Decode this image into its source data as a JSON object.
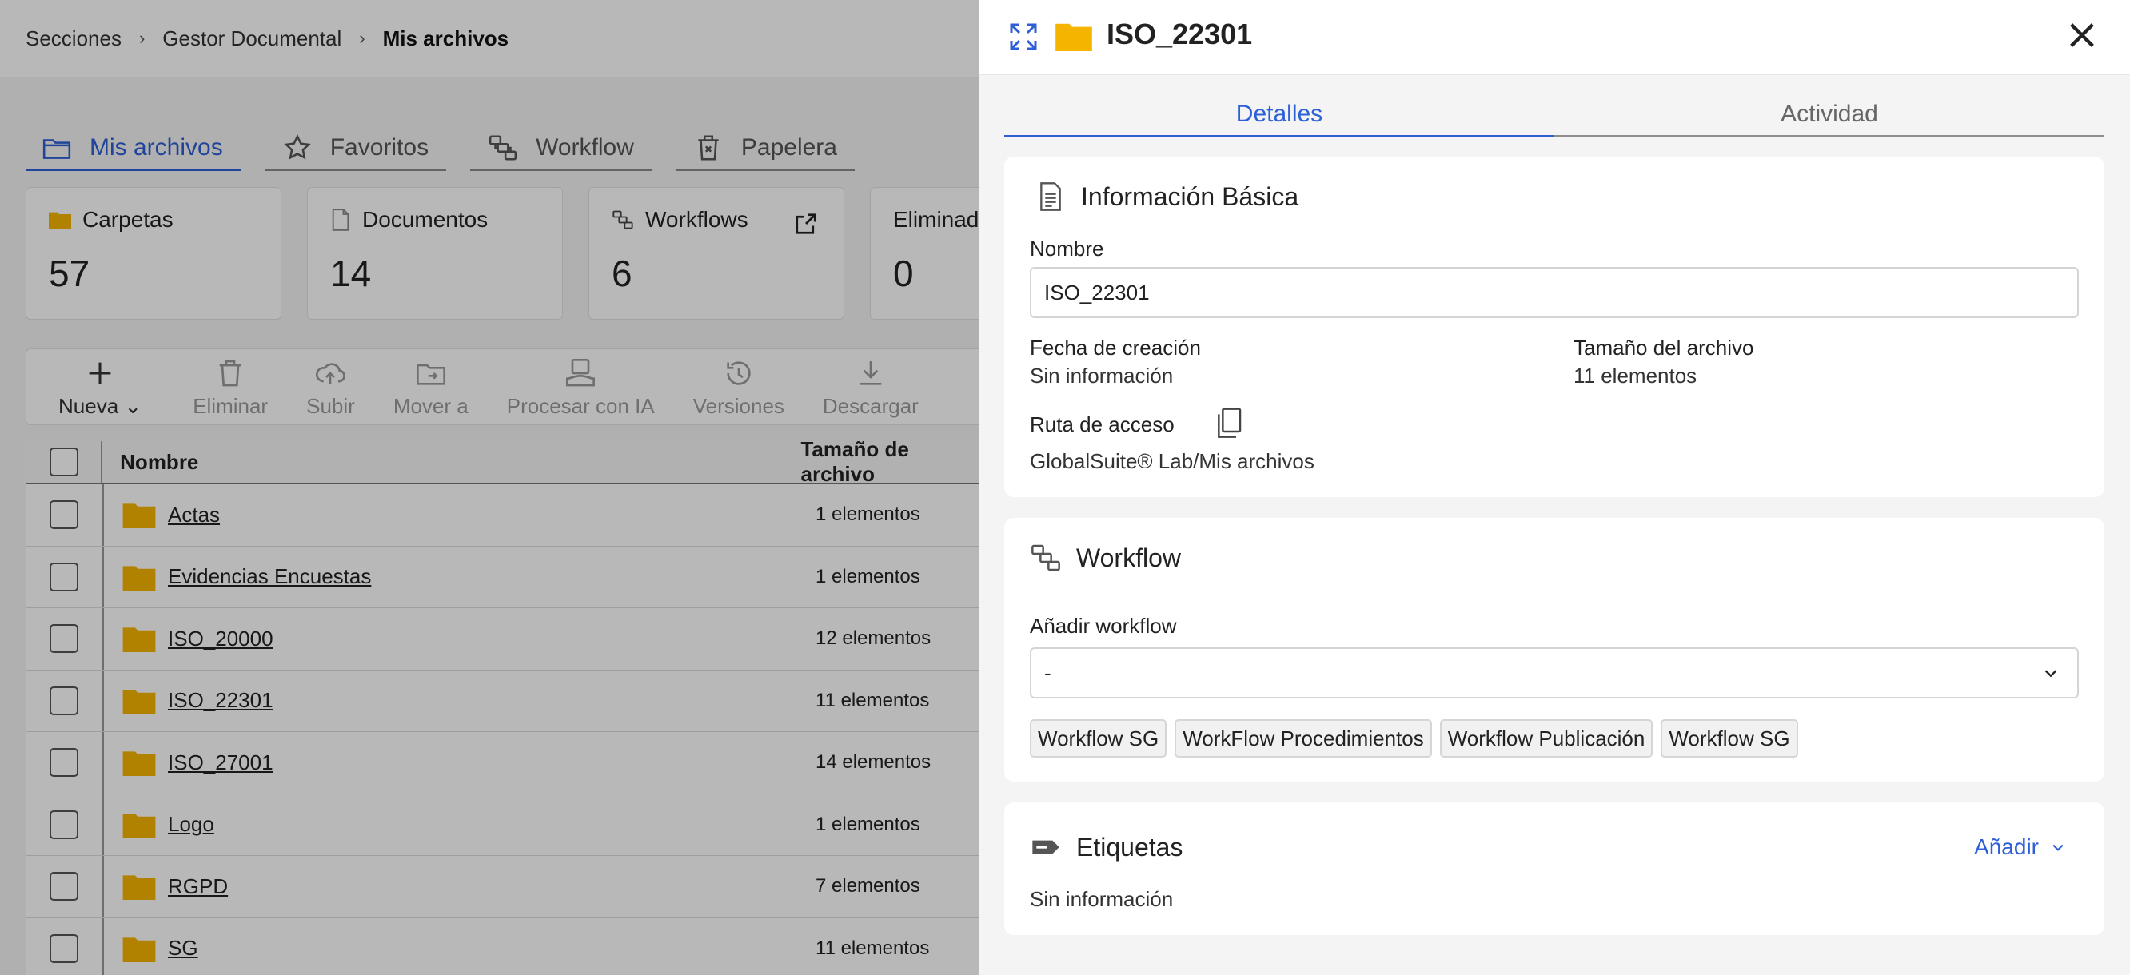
{
  "breadcrumb": [
    "Secciones",
    "Gestor Documental",
    "Mis archivos"
  ],
  "tabs": [
    {
      "label": "Mis archivos",
      "icon": "folder-outline-icon",
      "active": true
    },
    {
      "label": "Favoritos",
      "icon": "star-icon"
    },
    {
      "label": "Workflow",
      "icon": "workflow-icon"
    },
    {
      "label": "Papelera",
      "icon": "trash-icon"
    }
  ],
  "cards": [
    {
      "label": "Carpetas",
      "value": "57"
    },
    {
      "label": "Documentos",
      "value": "14"
    },
    {
      "label": "Workflows",
      "value": "6"
    },
    {
      "label": "Eliminados",
      "value": "0"
    }
  ],
  "toolbar": [
    "Nueva",
    "Eliminar",
    "Subir",
    "Mover a",
    "Procesar con IA",
    "Versiones",
    "Descargar"
  ],
  "table": {
    "headers": [
      "Nombre",
      "Tamaño de archivo"
    ],
    "rows": [
      {
        "name": "Actas",
        "size": "1 elementos"
      },
      {
        "name": "Evidencias Encuestas",
        "size": "1 elementos"
      },
      {
        "name": "ISO_20000",
        "size": "12 elementos"
      },
      {
        "name": "ISO_22301",
        "size": "11 elementos"
      },
      {
        "name": "ISO_27001",
        "size": "14 elementos"
      },
      {
        "name": "Logo",
        "size": "1 elementos"
      },
      {
        "name": "RGPD",
        "size": "7 elementos"
      },
      {
        "name": "SG",
        "size": "11 elementos"
      }
    ]
  },
  "panel": {
    "title": "ISO_22301",
    "tabs": [
      "Detalles",
      "Actividad"
    ],
    "basic": {
      "title": "Información Básica",
      "name_label": "Nombre",
      "name_value": "ISO_22301",
      "created_label": "Fecha de creación",
      "created_value": "Sin información",
      "size_label": "Tamaño del archivo",
      "size_value": "11 elementos",
      "path_label": "Ruta de acceso",
      "path_value": "GlobalSuite® Lab/Mis archivos"
    },
    "workflow": {
      "title": "Workflow",
      "add_label": "Añadir workflow",
      "select_value": "-",
      "chips": [
        "Workflow SG",
        "WorkFlow Procedimientos",
        "Workflow Publicación",
        "Workflow SG"
      ]
    },
    "tags": {
      "title": "Etiquetas",
      "add_label": "Añadir",
      "value": "Sin información"
    }
  },
  "colors": {
    "accent": "#2d5fd6",
    "folder": "#f5b400"
  }
}
